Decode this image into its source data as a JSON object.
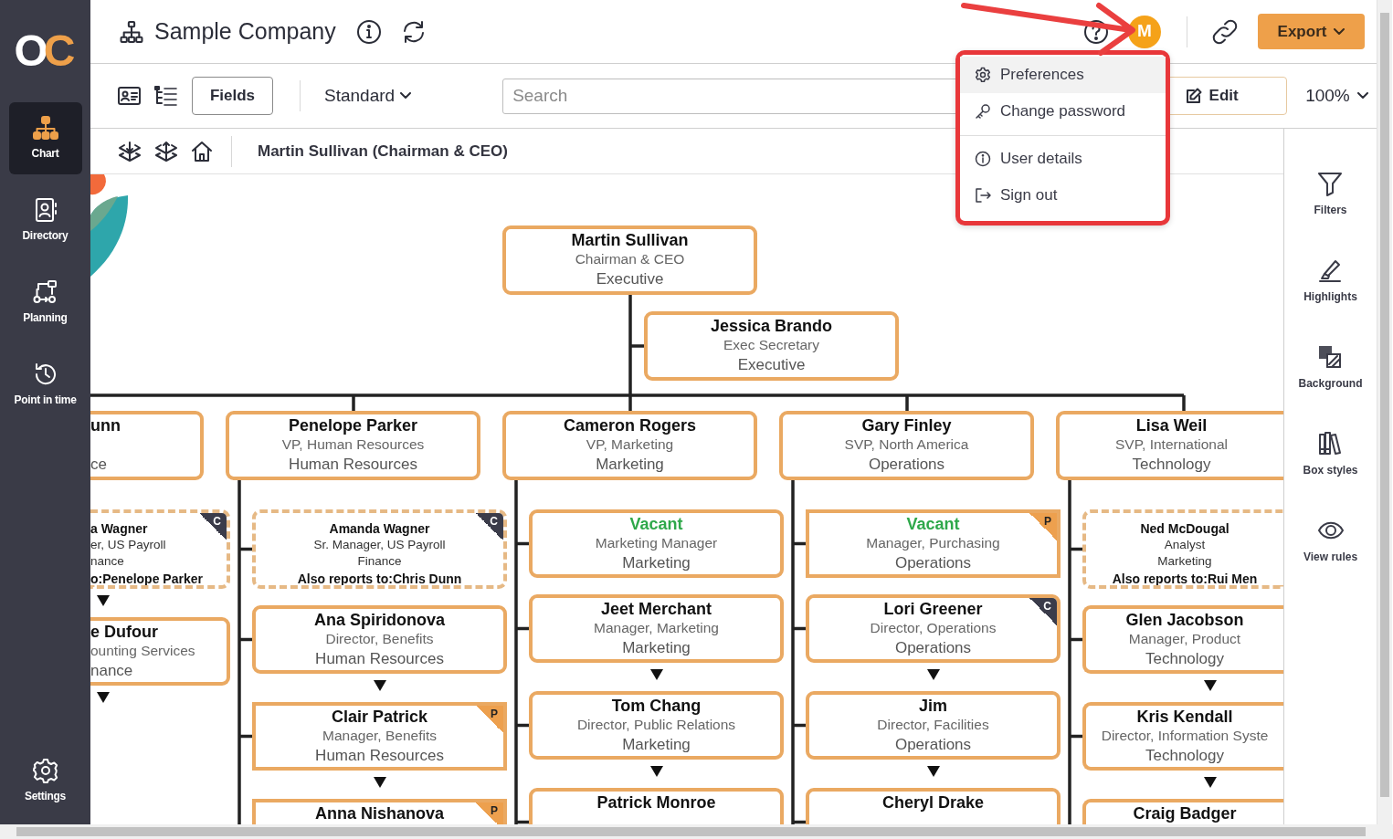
{
  "sidebar": {
    "logo": {
      "first": "O",
      "second": "C"
    },
    "items": [
      {
        "label": "Chart",
        "selected": true
      },
      {
        "label": "Directory",
        "selected": false
      },
      {
        "label": "Planning",
        "selected": false
      },
      {
        "label": "Point in time",
        "selected": false
      }
    ],
    "settings": {
      "label": "Settings"
    }
  },
  "header": {
    "title": "Sample Company",
    "avatar": "M",
    "export": "Export"
  },
  "toolbar": {
    "fields": "Fields",
    "layout": "Standard",
    "search": {
      "placeholder": "Search"
    },
    "edit": "Edit",
    "zoom": "100%"
  },
  "user_menu": {
    "groups": [
      [
        {
          "label": "Preferences",
          "highlighted": true
        },
        {
          "label": "Change password",
          "highlighted": false
        }
      ],
      [
        {
          "label": "User details",
          "highlighted": false
        },
        {
          "label": "Sign out",
          "highlighted": false
        }
      ]
    ]
  },
  "breadcrumb": "Martin Sullivan (Chairman & CEO)",
  "right_panel": [
    {
      "label": "Filters"
    },
    {
      "label": "Highlights"
    },
    {
      "label": "Background"
    },
    {
      "label": "Box styles"
    },
    {
      "label": "View rules"
    }
  ],
  "chart": {
    "root": {
      "kind": "solid",
      "name": "Martin Sullivan",
      "title": "Chairman & CEO",
      "department": "Executive"
    },
    "assistant": {
      "kind": "solid",
      "name": "Jessica Brando",
      "title": "Exec Secretary",
      "department": "Executive"
    },
    "departments": [
      {
        "kind": "solid",
        "name": "unn",
        "department": "ce",
        "children": [
          {
            "kind": "dashed",
            "name": "a Wagner",
            "title": "er, US Payroll",
            "department": "nance",
            "note": "o:Penelope Parker",
            "corner_tag": {
              "label": "C",
              "color": "#3b3c4a"
            },
            "collapsed": true
          },
          {
            "kind": "solid",
            "name": "e Dufour",
            "title": "ounting Services",
            "department": "nance",
            "collapsed": true
          }
        ]
      },
      {
        "kind": "solid",
        "name": "Penelope Parker",
        "title": "VP, Human Resources",
        "department": "Human Resources",
        "children": [
          {
            "kind": "dashed",
            "name": "Amanda Wagner",
            "title": "Sr. Manager, US Payroll",
            "department": "Finance",
            "note": "Also reports to:Chris  Dunn",
            "corner_tag": {
              "label": "C",
              "color": "#3b3c4a"
            },
            "collapsed": false
          },
          {
            "kind": "solid",
            "name": "Ana Spiridonova",
            "title": "Director, Benefits",
            "department": "Human Resources",
            "collapsed": true
          },
          {
            "kind": "square",
            "name": "Clair Patrick",
            "title": "Manager, Benefits",
            "department": "Human Resources",
            "corner_tag": {
              "label": "P",
              "color": "#eda04e"
            },
            "collapsed": true
          },
          {
            "kind": "square",
            "name": "Anna Nishanova",
            "corner_tag": {
              "label": "P",
              "color": "#eda04e"
            },
            "collapsed": false
          }
        ]
      },
      {
        "kind": "solid",
        "name": "Cameron Rogers",
        "title": "VP, Marketing",
        "department": "Marketing",
        "children": [
          {
            "kind": "solid",
            "vacant": true,
            "name": "Vacant",
            "title": "Marketing Manager",
            "department": "Marketing",
            "collapsed": false
          },
          {
            "kind": "solid",
            "name": "Jeet Merchant",
            "title": "Manager, Marketing",
            "department": "Marketing",
            "collapsed": true
          },
          {
            "kind": "solid",
            "name": "Tom Chang",
            "title": "Director, Public Relations",
            "department": "Marketing",
            "collapsed": true
          },
          {
            "kind": "solid",
            "name": "Patrick Monroe",
            "collapsed": false
          }
        ]
      },
      {
        "kind": "solid",
        "name": "Gary Finley",
        "title": "SVP, North America",
        "department": "Operations",
        "children": [
          {
            "kind": "square",
            "vacant": true,
            "name": "Vacant",
            "title": "Manager, Purchasing",
            "department": "Operations",
            "corner_tag": {
              "label": "P",
              "color": "#eda04e"
            },
            "collapsed": false
          },
          {
            "kind": "solid",
            "name": "Lori Greener",
            "title": "Director, Operations",
            "department": "Operations",
            "corner_tag": {
              "label": "C",
              "color": "#3b3c4a"
            },
            "collapsed": true
          },
          {
            "kind": "solid",
            "name": "Jim",
            "title": "Director, Facilities",
            "department": "Operations",
            "collapsed": true
          },
          {
            "kind": "solid",
            "name": "Cheryl Drake",
            "collapsed": false
          }
        ]
      },
      {
        "kind": "solid",
        "name": "Lisa Weil",
        "title": "SVP, International",
        "department": "Technology",
        "children": [
          {
            "kind": "dashed",
            "name": "Ned McDougal",
            "title": "Analyst",
            "department": "Marketing",
            "note": "Also reports to:Rui Men",
            "collapsed": false
          },
          {
            "kind": "solid",
            "name": "Glen Jacobson",
            "title": "Manager, Product",
            "department": "Technology",
            "collapsed": true
          },
          {
            "kind": "solid",
            "name": "Kris Kendall",
            "title": "Director, Information Syste",
            "department": "Technology",
            "collapsed": true
          },
          {
            "kind": "solid",
            "name": "Craig Badger",
            "collapsed": false
          }
        ]
      }
    ]
  }
}
